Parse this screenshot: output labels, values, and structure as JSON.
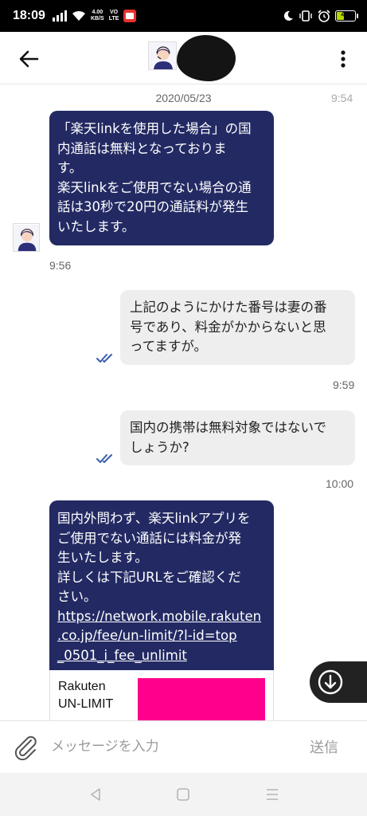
{
  "status_bar": {
    "time": "18:09",
    "net_speed_value": "4.00",
    "net_speed_unit": "KB/S",
    "network_type_1": "VO",
    "network_type_2": "LTE",
    "battery_level": 41,
    "battery_text": "41"
  },
  "header": {
    "back_icon": "arrow-left-icon",
    "more_icon": "more-vertical-icon"
  },
  "chat": {
    "date": "2020/05/23",
    "messages": [
      {
        "direction": "incoming",
        "lines": [
          "「楽天linkを使用した場合」の国",
          "内通話は無料となっておりま",
          "す。",
          "楽天linkをご使用でない場合の通",
          "話は30秒で20円の通話料が発生",
          "いたします。"
        ],
        "time": "9:56"
      },
      {
        "direction": "outgoing",
        "lines": [
          "上記のようにかけた番号は妻の番",
          "号であり、料金がかからないと思",
          "ってますが。"
        ],
        "time": "9:59",
        "read": true
      },
      {
        "direction": "outgoing",
        "lines": [
          "国内の携帯は無料対象ではないで",
          "しょうか?"
        ],
        "time": "10:00",
        "read": true
      },
      {
        "direction": "incoming",
        "lines": [
          "国内外問わず、楽天linkアプリを",
          "ご使用でない通話には料金が発",
          "生いたします。",
          "詳しくは下記URLをご確認くだ",
          "さい。"
        ],
        "url_lines": [
          "https://network.mobile.rakuten",
          ".co.jp/fee/un-limit/?l-id=top",
          "_0501_i_fee_unlimit"
        ]
      }
    ],
    "partial_time_top": "9:54",
    "link_preview": {
      "title_lines": [
        "Rakuten",
        "UN-LIMIT"
      ],
      "image_color": "#ff008c"
    },
    "scroll_down_icon": "arrow-down-circle-icon"
  },
  "composer": {
    "attach_icon": "paperclip-icon",
    "placeholder": "メッセージを入力",
    "send_label": "送信"
  },
  "navbar": {
    "back_icon": "nav-back-icon",
    "home_icon": "nav-home-icon",
    "recents_icon": "nav-recents-icon"
  },
  "colors": {
    "incoming_bubble": "#232a63",
    "outgoing_bubble": "#eeeeee",
    "read_check": "#3a5fae"
  }
}
